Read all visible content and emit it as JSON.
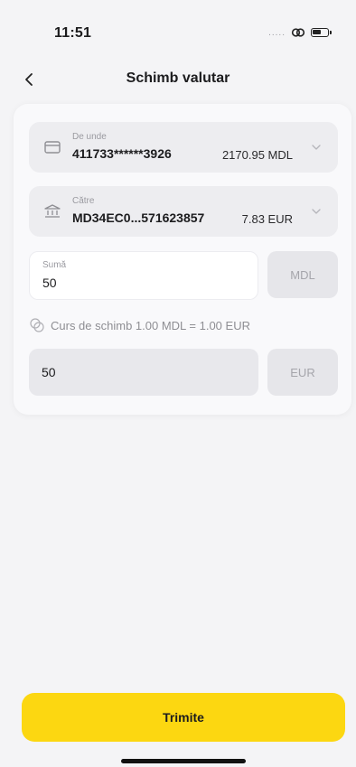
{
  "status_bar": {
    "time": "11:51",
    "signal": "....."
  },
  "header": {
    "title": "Schimb valutar"
  },
  "from_account": {
    "label": "De unde",
    "number": "411733******3926",
    "balance": "2170.95 MDL",
    "icon": "card-icon"
  },
  "to_account": {
    "label": "Către",
    "number": "MD34EC0...571623857",
    "balance": "7.83 EUR",
    "icon": "bank-icon"
  },
  "amount": {
    "label": "Sumă",
    "value": "50",
    "currency": "MDL"
  },
  "rate": {
    "text": "Curs de schimb 1.00 MDL = 1.00 EUR",
    "icon": "exchange-icon"
  },
  "result": {
    "value": "50",
    "currency": "EUR"
  },
  "submit": {
    "label": "Trimite"
  },
  "colors": {
    "accent": "#fcd711",
    "background": "#f4f4f6"
  }
}
